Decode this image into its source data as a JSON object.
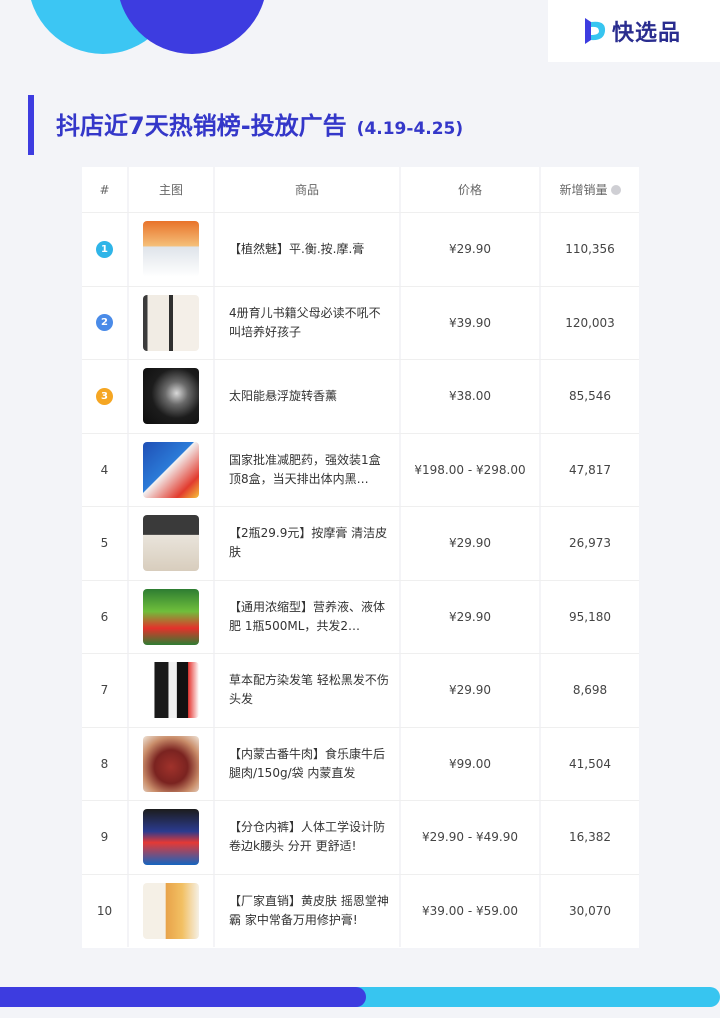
{
  "brand": {
    "name": "快选品"
  },
  "title": {
    "main": "抖店近7天热销榜-投放广告",
    "date_range": "(4.19-4.25)"
  },
  "table": {
    "headers": {
      "rank": "#",
      "image": "主图",
      "name": "商品",
      "price": "价格",
      "sales": "新增销量"
    },
    "rows": [
      {
        "rank": "1",
        "name": "【植然魅】平.衡.按.摩.膏",
        "price": "¥29.90",
        "sales": "110,356"
      },
      {
        "rank": "2",
        "name": "4册育儿书籍父母必读不吼不叫培养好孩子",
        "price": "¥39.90",
        "sales": "120,003"
      },
      {
        "rank": "3",
        "name": "太阳能悬浮旋转香薰",
        "price": "¥38.00",
        "sales": "85,546"
      },
      {
        "rank": "4",
        "name": "国家批准减肥药，强效装1盒顶8盒，当天排出体内黑…",
        "price": "¥198.00 - ¥298.00",
        "sales": "47,817"
      },
      {
        "rank": "5",
        "name": "【2瓶29.9元】按摩膏 清洁皮肤",
        "price": "¥29.90",
        "sales": "26,973"
      },
      {
        "rank": "6",
        "name": "【通用浓缩型】营养液、液体肥 1瓶500ML，共发2…",
        "price": "¥29.90",
        "sales": "95,180"
      },
      {
        "rank": "7",
        "name": "草本配方染发笔 轻松黑发不伤头发",
        "price": "¥29.90",
        "sales": "8,698"
      },
      {
        "rank": "8",
        "name": "【内蒙古番牛肉】食乐康牛后腿肉/150g/袋 内蒙直发",
        "price": "¥99.00",
        "sales": "41,504"
      },
      {
        "rank": "9",
        "name": "【分仓内裤】人体工学设计防卷边k腰头 分开 更舒适!",
        "price": "¥29.90 - ¥49.90",
        "sales": "16,382"
      },
      {
        "rank": "10",
        "name": "【厂家直销】黄皮肤 摇恩堂神霸 家中常备万用修护膏!",
        "price": "¥39.00 - ¥59.00",
        "sales": "30,070"
      }
    ]
  },
  "colors": {
    "accent_blue": "#3d3ce0",
    "accent_cyan": "#37c5f0",
    "title_color": "#3437c9",
    "medal_1": "#2fb5e8",
    "medal_2": "#4a8be8",
    "medal_3": "#f5a623"
  }
}
